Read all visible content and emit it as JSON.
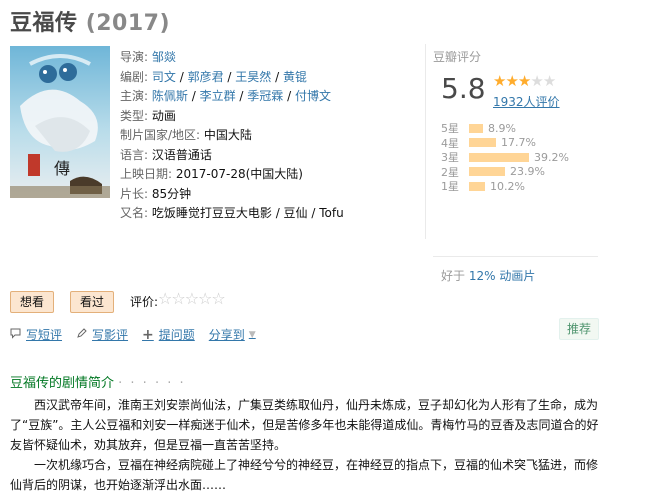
{
  "title": "豆福传",
  "year": "(2017)",
  "info": {
    "director_label": "导演:",
    "director": "邹燚",
    "writer_label": "编剧:",
    "writers": [
      "司文",
      "郭彦君",
      "王昊然",
      "黄锟"
    ],
    "cast_label": "主演:",
    "cast": [
      "陈佩斯",
      "李立群",
      "季冠霖",
      "付博文"
    ],
    "genre_label": "类型:",
    "genre": "动画",
    "country_label": "制片国家/地区:",
    "country": "中国大陆",
    "language_label": "语言:",
    "language": "汉语普通话",
    "release_label": "上映日期:",
    "release": "2017-07-28(中国大陆)",
    "runtime_label": "片长:",
    "runtime": "85分钟",
    "aka_label": "又名:",
    "aka": "吃饭睡觉打豆豆大电影 / 豆仙 / Tofu"
  },
  "rating": {
    "title": "豆瓣评分",
    "score": "5.8",
    "stars_on": 3,
    "votes": "1932人评价",
    "histogram": [
      {
        "label": "5星",
        "pct": "8.9%",
        "value": 8.9
      },
      {
        "label": "4星",
        "pct": "17.7%",
        "value": 17.7
      },
      {
        "label": "3星",
        "pct": "39.2%",
        "value": 39.2
      },
      {
        "label": "2星",
        "pct": "23.9%",
        "value": 23.9
      },
      {
        "label": "1星",
        "pct": "10.2%",
        "value": 10.2
      }
    ],
    "better_than_prefix": "好于 ",
    "better_than_pct": "12%",
    "better_than_genre": "动画片"
  },
  "actions": {
    "want": "想看",
    "seen": "看过",
    "rate_label": "评价:"
  },
  "tools": {
    "short_review": "写短评",
    "review": "写影评",
    "question": "提问题",
    "share": "分享到",
    "recommend": "推荐"
  },
  "summary": {
    "title": "豆福传的剧情简介",
    "dots": "· · · · · ·",
    "p1": "西汉武帝年间，淮南王刘安崇尚仙法，广集豆类练取仙丹，仙丹未炼成，豆子却幻化为人形有了生命，成为了“豆族”。主人公豆福和刘安一样痴迷于仙术，但是苦修多年也未能得道成仙。青梅竹马的豆香及志同道合的好友皆怀疑仙术，劝其放弃，但是豆福一直苦苦坚持。",
    "p2": "一次机缘巧合，豆福在神经病院碰上了神经兮兮的神经豆，在神经豆的指点下，豆福的仙术突飞猛进，而修仙背后的阴谋，也开始逐渐浮出水面……"
  },
  "colors": {
    "link": "#3377aa",
    "star_on": "#ffac2d",
    "bar": "#ffd596",
    "section_green": "#007722"
  }
}
